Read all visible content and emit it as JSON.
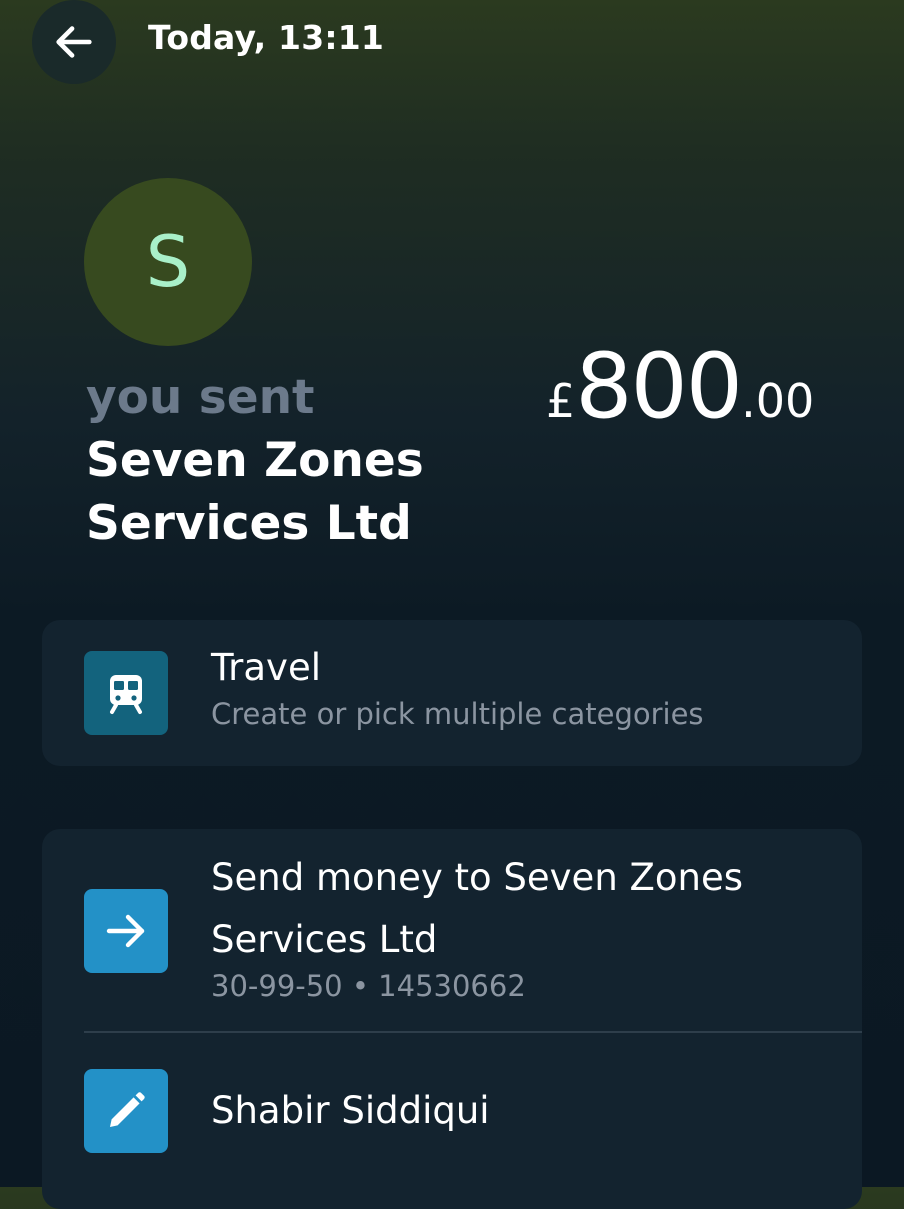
{
  "header": {
    "time": "Today, 13:11"
  },
  "icons": {
    "back": "arrow-left-icon",
    "travel": "train-icon",
    "send": "arrow-right-icon",
    "note": "pencil-icon"
  },
  "transaction": {
    "avatar_letter": "S",
    "prefix": "you sent",
    "recipient": "Seven Zones Services Ltd",
    "currency": "£",
    "amount_whole": "800",
    "amount_decimal": ".00"
  },
  "category": {
    "title": "Travel",
    "subtitle": "Create or pick multiple categories"
  },
  "send_again": {
    "title": "Send money to Seven Zones Services Ltd",
    "details": "30-99-50 • 14530662"
  },
  "note": {
    "text": "Shabir Siddiqui"
  },
  "colors": {
    "avatar_bg": "#374a1f",
    "avatar_letter": "#a9f0c9",
    "card_bg": "#13232f",
    "travel_tile": "#13637d",
    "action_tile": "#2391c7",
    "muted_text": "#6c7a8b"
  }
}
